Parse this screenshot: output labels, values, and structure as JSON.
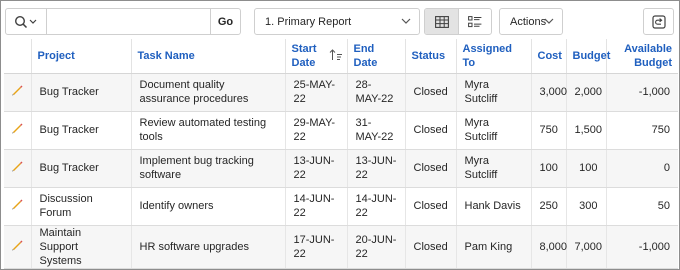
{
  "toolbar": {
    "search_icon": "search-icon",
    "search_value": "",
    "go_label": "Go",
    "report_selected": "1. Primary Report",
    "actions_label": "Actions",
    "grid_view_icon": "grid-view-icon",
    "detail_view_icon": "detail-view-icon",
    "reset_icon": "reset-icon"
  },
  "table": {
    "headers": {
      "project": "Project",
      "task_name": "Task Name",
      "start_date": "Start Date",
      "end_date": "End Date",
      "status": "Status",
      "assigned_to": "Assigned To",
      "cost": "Cost",
      "budget": "Budget",
      "available_budget": "Available Budget"
    },
    "sort": {
      "column": "start_date",
      "direction": "ascending"
    },
    "rows": [
      {
        "project": "Bug Tracker",
        "task": "Document quality assurance procedures",
        "start": "25-MAY-22",
        "end": "28-MAY-22",
        "status": "Closed",
        "assigned": "Myra Sutcliff",
        "cost": "3,000",
        "budget": "2,000",
        "available": "-1,000"
      },
      {
        "project": "Bug Tracker",
        "task": "Review automated testing tools",
        "start": "29-MAY-22",
        "end": "31-MAY-22",
        "status": "Closed",
        "assigned": "Myra Sutcliff",
        "cost": "750",
        "budget": "1,500",
        "available": "750"
      },
      {
        "project": "Bug Tracker",
        "task": "Implement bug tracking software",
        "start": "13-JUN-22",
        "end": "13-JUN-22",
        "status": "Closed",
        "assigned": "Myra Sutcliff",
        "cost": "100",
        "budget": "100",
        "available": "0"
      },
      {
        "project": "Discussion Forum",
        "task": "Identify owners",
        "start": "14-JUN-22",
        "end": "14-JUN-22",
        "status": "Closed",
        "assigned": "Hank Davis",
        "cost": "250",
        "budget": "300",
        "available": "50"
      },
      {
        "project": "Maintain Support Systems",
        "task": "HR software upgrades",
        "start": "17-JUN-22",
        "end": "20-JUN-22",
        "status": "Closed",
        "assigned": "Pam King",
        "cost": "8,000",
        "budget": "7,000",
        "available": "-1,000"
      }
    ]
  },
  "colors": {
    "header_text": "#1f5fbf",
    "edit_icon": "#e8a317"
  }
}
